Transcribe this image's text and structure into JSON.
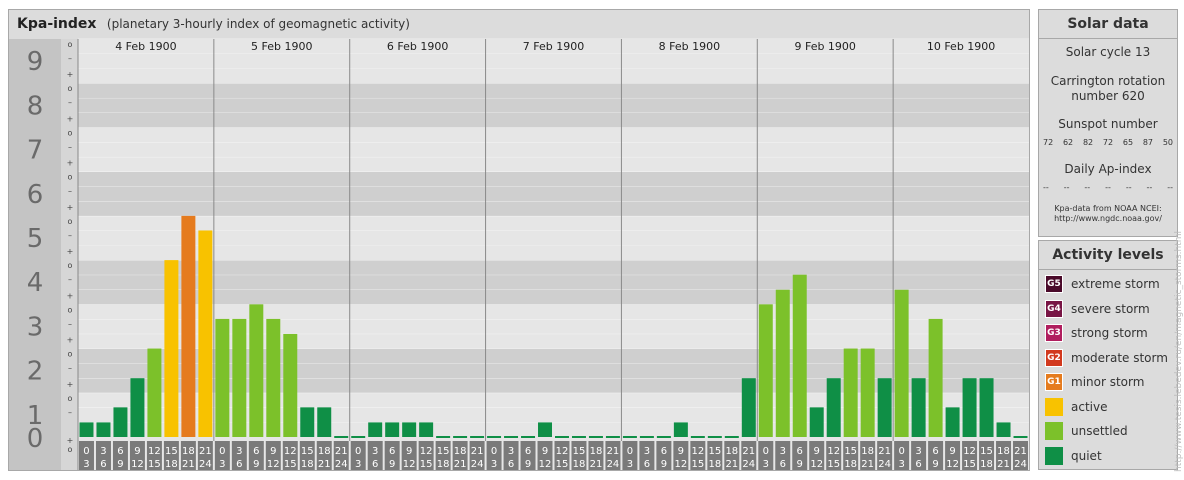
{
  "header": {
    "title": "Kpa-index",
    "subtitle": "(planetary 3-hourly index of geomagnetic activity)"
  },
  "solar": {
    "title": "Solar data",
    "cycle": "Solar cycle 13",
    "carrington_line1": "Carrington rotation",
    "carrington_line2": "number 620",
    "sunspot_title": "Sunspot number",
    "sunspot_values": [
      "72",
      "62",
      "82",
      "72",
      "65",
      "87",
      "50"
    ],
    "ap_title": "Daily Ap-index",
    "ap_values": [
      "--",
      "--",
      "--",
      "--",
      "--",
      "--",
      "--"
    ],
    "source_line1": "Kpa-data from NOAA NCEI:",
    "source_line2": "http://www.ngdc.noaa.gov/"
  },
  "activity": {
    "title": "Activity levels",
    "items": [
      {
        "code": "G5",
        "label": "extreme storm",
        "color": "#4a0a2a"
      },
      {
        "code": "G4",
        "label": "severe storm",
        "color": "#781545"
      },
      {
        "code": "G3",
        "label": "strong storm",
        "color": "#b01e5e"
      },
      {
        "code": "G2",
        "label": "moderate storm",
        "color": "#d2391e"
      },
      {
        "code": "G1",
        "label": "minor storm",
        "color": "#e57b1e"
      },
      {
        "code": "",
        "label": "active",
        "color": "#f8c200"
      },
      {
        "code": "",
        "label": "unsettled",
        "color": "#7cc12a"
      },
      {
        "code": "",
        "label": "quiet",
        "color": "#0f8f46"
      }
    ]
  },
  "watermark": "http://www.tesis.lebedev.ru/en/magnetic_storms.html",
  "chart_data": {
    "type": "bar",
    "ylim": [
      0,
      9
    ],
    "y_ticks": [
      "0",
      "1",
      "2",
      "3",
      "4",
      "5",
      "6",
      "7",
      "8",
      "9"
    ],
    "sub_ticks": [
      "+",
      "o",
      "–"
    ],
    "days": [
      "4 Feb 1900",
      "5 Feb 1900",
      "6 Feb 1900",
      "7 Feb 1900",
      "8 Feb 1900",
      "9 Feb 1900",
      "10 Feb 1900"
    ],
    "hour_start": [
      "0",
      "3",
      "6",
      "9",
      "12",
      "15",
      "18",
      "21"
    ],
    "hour_end": [
      "3",
      "6",
      "9",
      "12",
      "15",
      "18",
      "21",
      "24"
    ],
    "values": [
      0.33,
      0.33,
      0.67,
      1.33,
      2.0,
      4.0,
      5.0,
      4.67,
      2.67,
      2.67,
      3.0,
      2.67,
      2.33,
      0.67,
      0.67,
      0.0,
      0.0,
      0.33,
      0.33,
      0.33,
      0.33,
      0.0,
      0.0,
      0.0,
      0.0,
      0.0,
      0.0,
      0.33,
      0.0,
      0.0,
      0.0,
      0.0,
      0.0,
      0.0,
      0.0,
      0.33,
      0.0,
      0.0,
      0.0,
      1.33,
      3.0,
      3.33,
      3.67,
      0.67,
      1.33,
      2.0,
      2.0,
      1.33,
      3.33,
      1.33,
      2.67,
      0.67,
      1.33,
      1.33,
      0.33,
      0.0
    ]
  }
}
